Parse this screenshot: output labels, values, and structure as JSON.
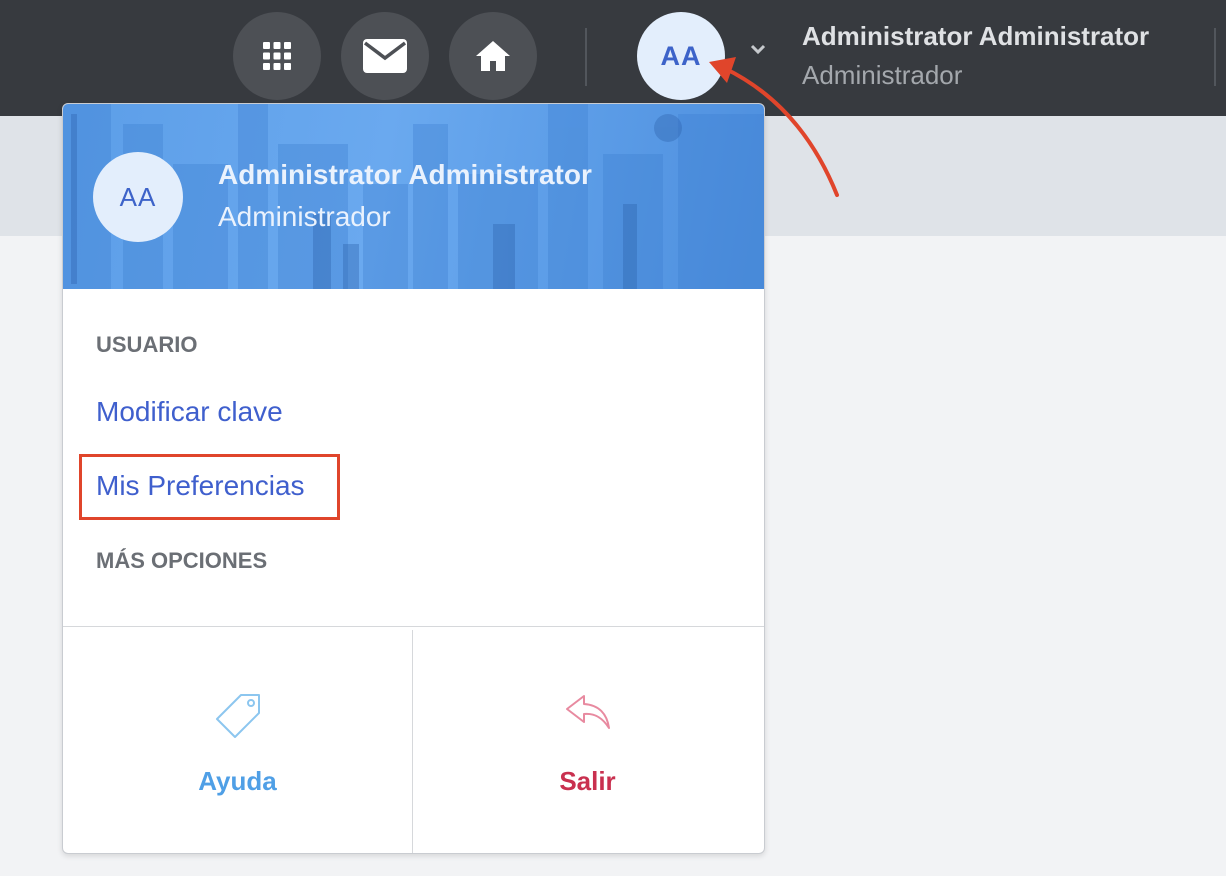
{
  "topbar": {
    "avatar_initials": "AA",
    "user_name": "Administrator Administrator",
    "user_role": "Administrador",
    "icons": [
      "apps-grid-icon",
      "mail-icon",
      "home-icon",
      "chevron-down-icon"
    ]
  },
  "dropdown": {
    "header": {
      "avatar_initials": "AA",
      "user_name": "Administrator Administrator",
      "user_role": "Administrador"
    },
    "section_user": "USUARIO",
    "items": [
      {
        "label": "Modificar clave"
      },
      {
        "label": "Mis Preferencias"
      }
    ],
    "section_more": "MÁS OPCIONES",
    "footer": {
      "help": {
        "label": "Ayuda",
        "icon": "tag-icon",
        "color": "#4f9fe6"
      },
      "logout": {
        "label": "Salir",
        "icon": "reply-icon",
        "color": "#c9304f"
      }
    }
  },
  "colors": {
    "topbar_bg": "#373a3f",
    "accent_link": "#3f5fcd",
    "highlight": "#e0452b"
  }
}
